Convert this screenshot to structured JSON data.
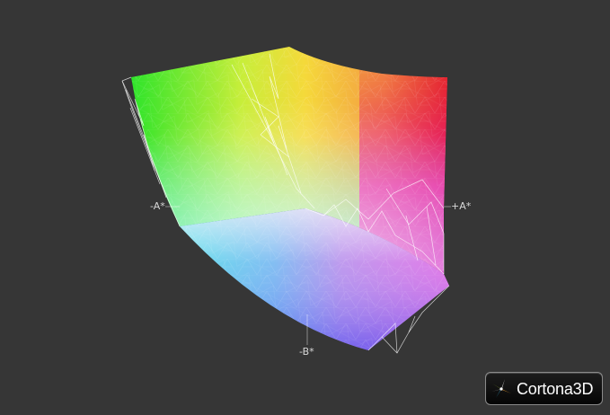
{
  "axis_labels": {
    "neg_a": "-A*",
    "pos_a": "+A*",
    "neg_b": "-B*"
  },
  "logo": {
    "text": "Cortona",
    "suffix": "3D"
  },
  "colors": {
    "background": "#363636",
    "wireframe": "#ffffff",
    "green": "#22e02a",
    "yellow": "#f2f22a",
    "orange": "#f59a3a",
    "red": "#e81e1e",
    "magenta": "#e81ea8",
    "violet": "#b64fe6",
    "blue": "#5a5ef0",
    "cyan": "#30e8e0",
    "center": "#f4f0f0"
  }
}
